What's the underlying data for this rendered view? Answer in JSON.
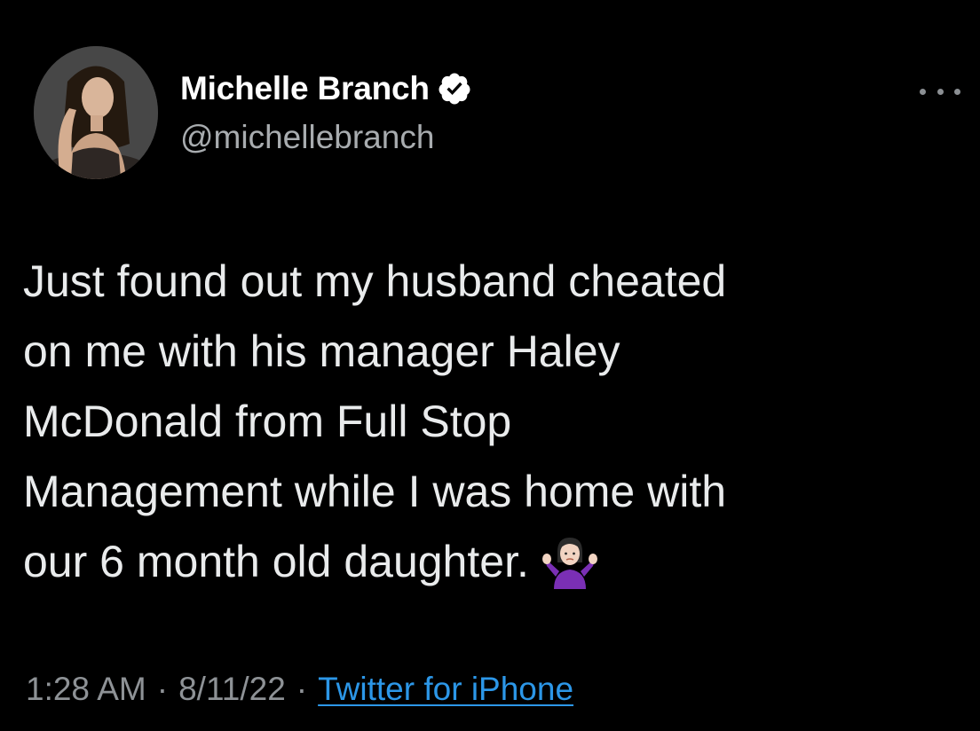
{
  "author": {
    "display_name": "Michelle Branch",
    "handle": "@michellebranch",
    "verified": true,
    "avatar_icon": "profile-photo"
  },
  "tweet": {
    "lines": [
      "Just found out my husband cheated",
      "on me with his manager Haley",
      "McDonald from Full Stop",
      "Management while I was home with",
      "our 6 month old daughter."
    ],
    "emoji": "person-shrugging-emoji"
  },
  "meta": {
    "time": "1:28 AM",
    "separator": "·",
    "date": "8/11/22",
    "source": "Twitter for iPhone"
  },
  "colors": {
    "background": "#000000",
    "name": "#ffffff",
    "text": "#e9ebec",
    "muted": "#8e9296",
    "link": "#2c97e8",
    "emoji_shirt": "#7a2fb5"
  },
  "icons": {
    "more": "more-horizontal-icon",
    "verified": "verified-badge-icon"
  }
}
